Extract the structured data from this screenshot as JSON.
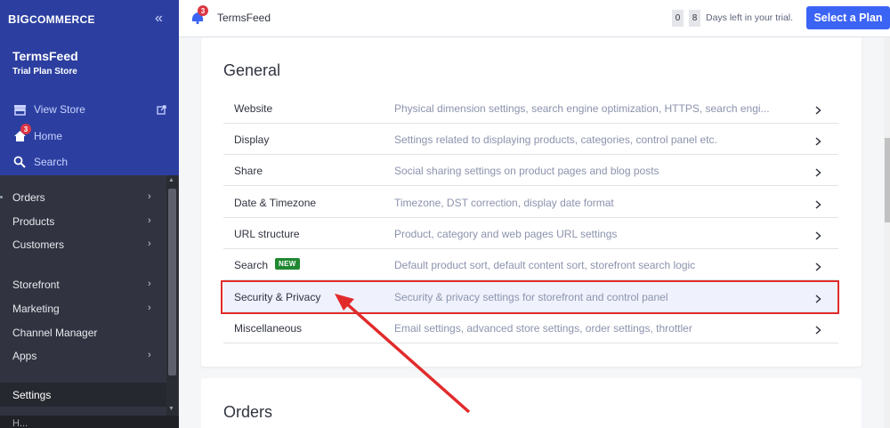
{
  "sidebar": {
    "logo": {
      "prefix": "BIG",
      "rest": "COMMERCE"
    },
    "store_name": "TermsFeed",
    "store_plan": "Trial Plan Store",
    "view_store": "View Store",
    "home": "Home",
    "home_badge": "3",
    "search": "Search",
    "nav": [
      "Orders",
      "Products",
      "Customers",
      "Storefront",
      "Marketing",
      "Channel Manager",
      "Apps",
      "Settings"
    ],
    "footer_partial": "H..."
  },
  "topbar": {
    "notif_badge": "3",
    "store": "TermsFeed",
    "days_digits": [
      "0",
      "8"
    ],
    "trial_text": "Days left in your trial.",
    "plan_button": "Select a Plan"
  },
  "general": {
    "title": "General",
    "rows": [
      {
        "label": "Website",
        "desc": "Physical dimension settings, search engine optimization, HTTPS, search engi..."
      },
      {
        "label": "Display",
        "desc": "Settings related to displaying products, categories, control panel etc."
      },
      {
        "label": "Share",
        "desc": "Social sharing settings on product pages and blog posts"
      },
      {
        "label": "Date & Timezone",
        "desc": "Timezone, DST correction, display date format"
      },
      {
        "label": "URL structure",
        "desc": "Product, category and web pages URL settings"
      },
      {
        "label": "Search",
        "desc": "Default product sort, default content sort, storefront search logic",
        "badge": "NEW"
      },
      {
        "label": "Security & Privacy",
        "desc": "Security & privacy settings for storefront and control panel"
      },
      {
        "label": "Miscellaneous",
        "desc": "Email settings, advanced store settings, order settings, throttler"
      }
    ]
  },
  "orders": {
    "title": "Orders"
  },
  "colors": {
    "brand": "#2c3fa0",
    "primary_button": "#3c64f4",
    "highlight": "#e12b2b",
    "new_badge": "#208831"
  }
}
